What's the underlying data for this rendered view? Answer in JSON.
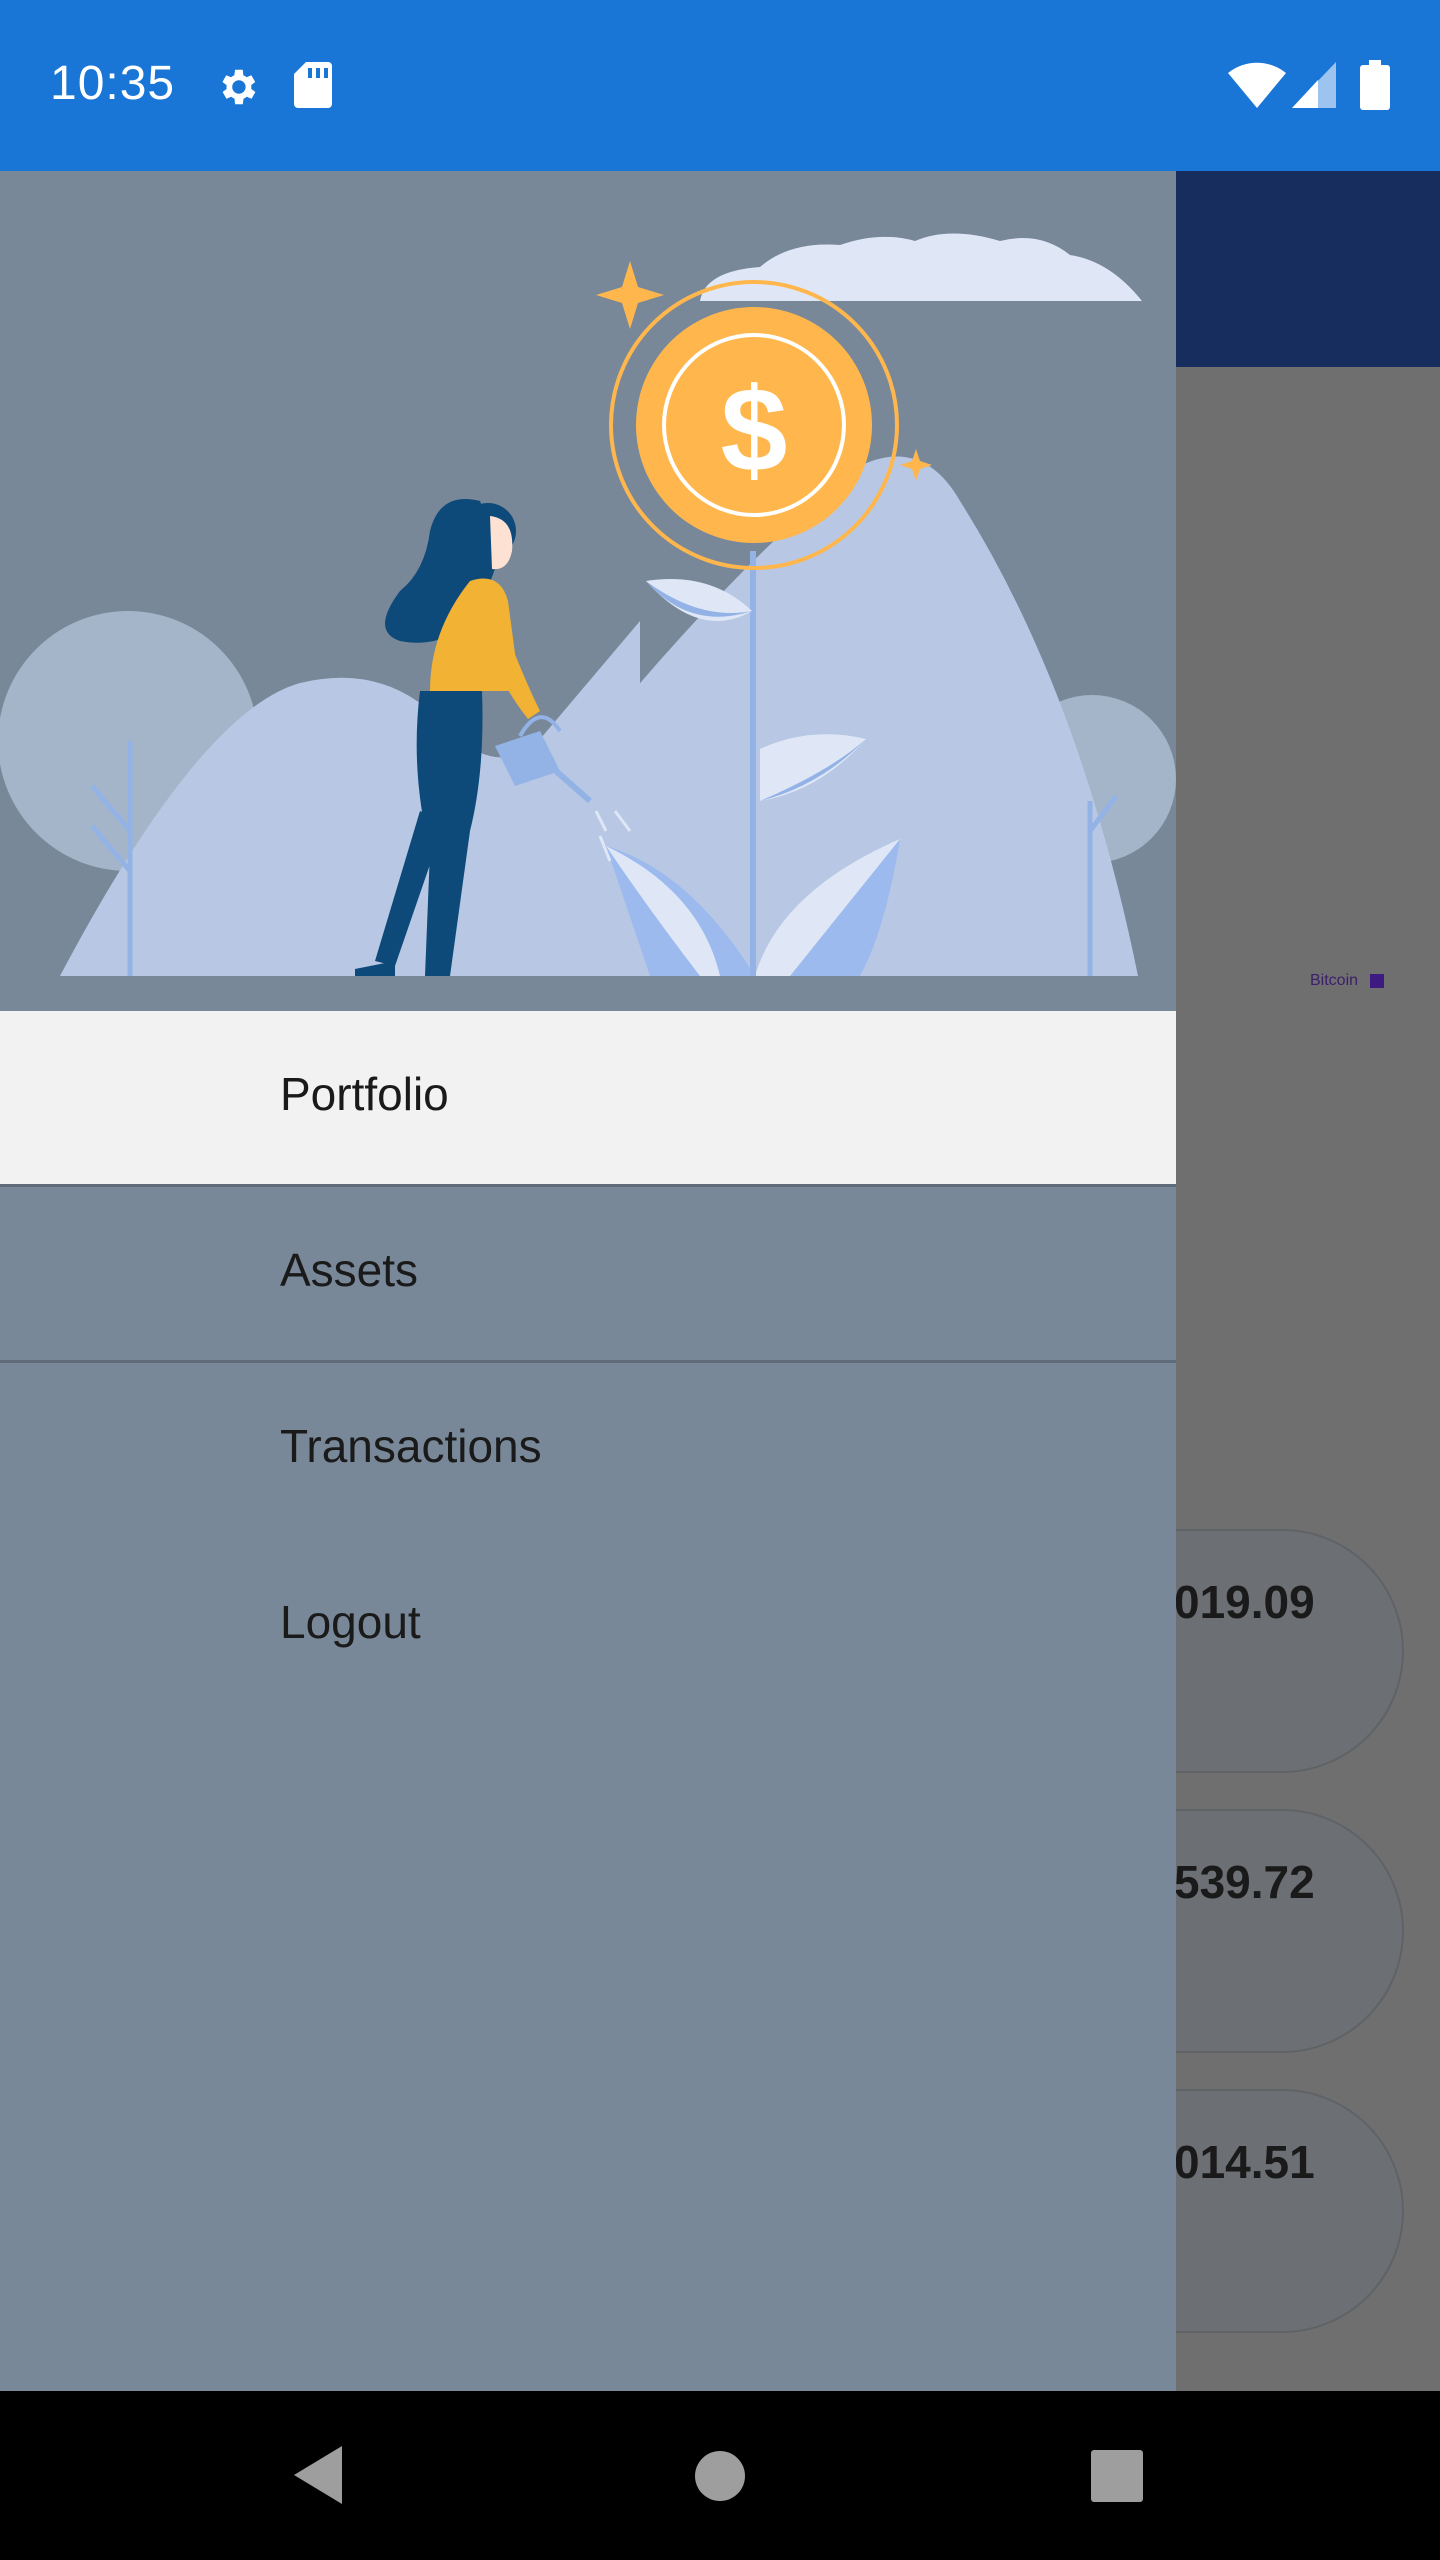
{
  "status_bar": {
    "time": "10:35",
    "icons": [
      "settings-icon",
      "sd-card-icon",
      "wifi-icon",
      "signal-icon",
      "battery-icon"
    ],
    "color": "#1976d6"
  },
  "background_screen": {
    "appbar_color": "#162d5e",
    "legend_label": "Bitcoin",
    "card_values": [
      "019.09",
      "539.72",
      "014.51"
    ]
  },
  "drawer": {
    "header_illustration": "woman-watering-money-plant-illustration",
    "items": [
      {
        "label": "Portfolio",
        "active": true
      },
      {
        "label": "Assets",
        "active": false
      },
      {
        "label": "Transactions",
        "active": false
      },
      {
        "label": "Logout",
        "active": false
      }
    ]
  },
  "nav_bar": {
    "buttons": [
      "back-icon",
      "home-icon",
      "recents-icon"
    ]
  },
  "colors": {
    "drawer_bg": "#788898",
    "active_item_bg": "#f2f2f2",
    "coin": "#ffb74d"
  }
}
